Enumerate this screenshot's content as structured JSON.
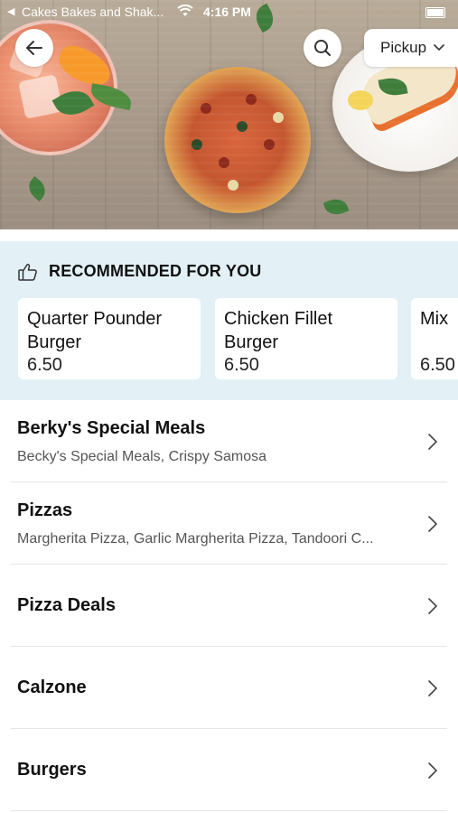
{
  "status_bar": {
    "back_glyph": "◀",
    "carrier": "Cakes Bakes and Shak...",
    "time": "4:16 PM"
  },
  "header": {
    "pickup_label": "Pickup",
    "back_icon": "arrow-left-icon",
    "search_icon": "search-icon",
    "pickup_chevron": "chevron-down-icon"
  },
  "recommended": {
    "title": "RECOMMENDED FOR YOU",
    "icon": "thumbs-up-icon",
    "background": "#e3f1f6",
    "items": [
      {
        "name": "Quarter Pounder Burger",
        "price": "6.50"
      },
      {
        "name": "Chicken Fillet Burger",
        "price": "6.50"
      },
      {
        "name": "Mix",
        "price": "6.50"
      }
    ]
  },
  "categories": [
    {
      "name": "Berky's Special Meals",
      "description": "Becky's Special Meals, Crispy Samosa"
    },
    {
      "name": "Pizzas",
      "description": "Margherita Pizza, Garlic Margherita Pizza, Tandoori C..."
    },
    {
      "name": "Pizza Deals",
      "description": ""
    },
    {
      "name": "Calzone",
      "description": ""
    },
    {
      "name": "Burgers",
      "description": ""
    }
  ]
}
